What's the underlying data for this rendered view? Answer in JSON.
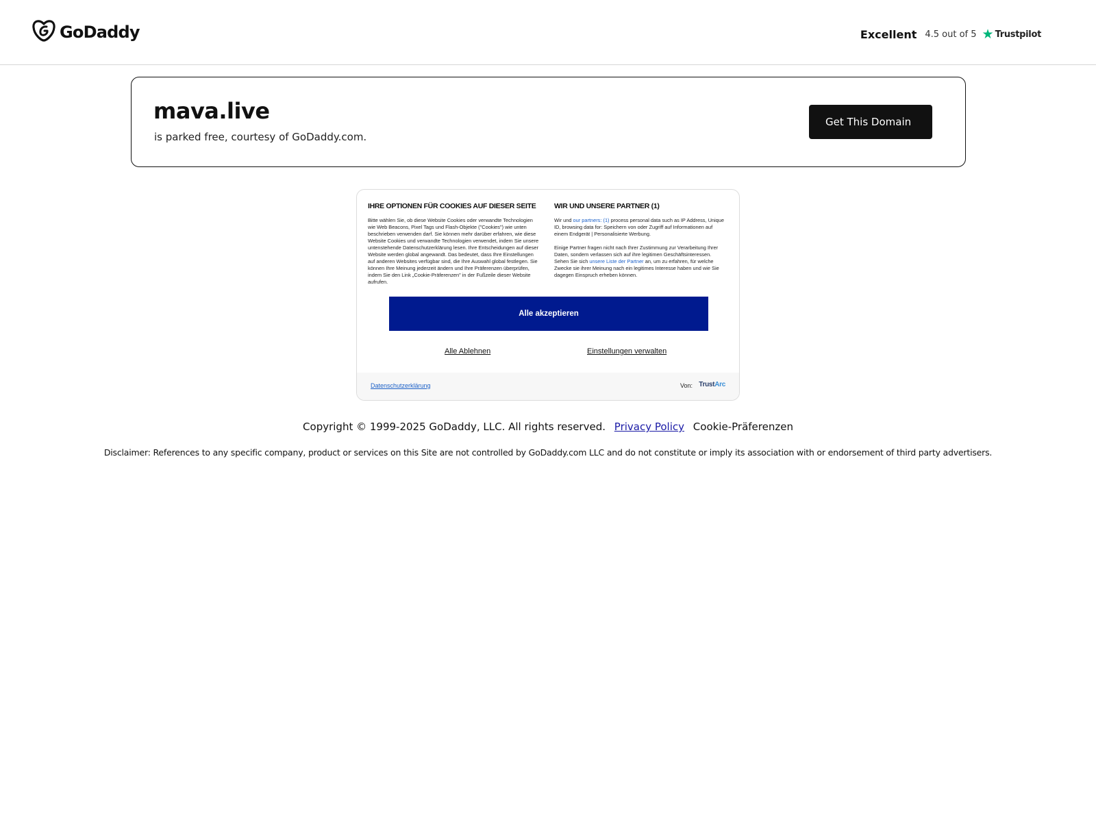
{
  "header": {
    "logo_text": "GoDaddy",
    "rating": {
      "label": "Excellent",
      "score_text": "4.5 out of 5",
      "provider": "Trustpilot"
    }
  },
  "domain_card": {
    "domain": "mava.live",
    "subtitle": "is parked free, courtesy of GoDaddy.com.",
    "cta_label": "Get This Domain"
  },
  "cookie_banner": {
    "left_title": "IHRE OPTIONEN FÜR COOKIES AUF DIESER SEITE",
    "left_text": "Bitte wählen Sie, ob diese Website Cookies oder verwandte Technologien wie Web Beacons, Pixel Tags und Flash-Objekte (\"Cookies\") wie unten beschrieben verwenden darf. Sie können mehr darüber erfahren, wie diese Website Cookies und verwandte Technologien verwendet, indem Sie unsere untenstehende Datenschutzerklärung lesen. Ihre Entscheidungen auf dieser Website werden global angewandt. Das bedeutet, dass Ihre Einstellungen auf anderen Websites verfügbar sind, die Ihre Auswahl global festlegen. Sie können Ihre Meinung jederzeit ändern und Ihre Präferenzen überprüfen, indem Sie den Link „Cookie-Präferenzen\" in der Fußzeile dieser Website aufrufen.",
    "right_title": "WIR UND UNSERE PARTNER (1)",
    "right_text_1_prefix": "Wir und ",
    "right_text_1_link": "our partners: (1)",
    "right_text_1_suffix": " process personal data such as IP Address, Unique ID, browsing data for: Speichern von oder Zugriff auf Informationen auf einem Endgerät | Personalisierte Werbung.",
    "right_text_2_prefix": "Einige Partner fragen nicht nach Ihrer Zustimmung zur Verarbeitung Ihrer Daten, sondern verlassen sich auf ihre legitimen Geschäftsinteressen. Sehen Sie sich ",
    "right_text_2_link": "unsere Liste der Partner",
    "right_text_2_suffix": " an, um zu erfahren, für welche Zwecke sie ihrer Meinung nach ein legitimes Interesse haben und wie Sie dagegen Einspruch erheben können.",
    "accept_label": "Alle akzeptieren",
    "reject_label": "Alle Ablehnen",
    "settings_label": "Einstellungen verwalten",
    "privacy_label": "Datenschutzerklärung",
    "by_label": "Von:",
    "brand_trust": "Trust",
    "brand_arc": "Arc"
  },
  "footer": {
    "copyright": "Copyright © 1999-2025 GoDaddy, LLC. All rights reserved.",
    "privacy_policy": "Privacy Policy",
    "cookie_prefs": "Cookie-Präferenzen",
    "disclaimer": "Disclaimer: References to any specific company, product or services on this Site are not controlled by GoDaddy.com LLC and do not constitute or imply its association with or endorsement of third party advertisers."
  },
  "colors": {
    "accept_button": "#001a8f",
    "cta_button": "#111111",
    "trustpilot_star": "#00b67a",
    "link": "#1a5fc7"
  },
  "icons": {
    "logo": "godaddy-logo-icon",
    "rating_star": "trustpilot-star-icon"
  }
}
